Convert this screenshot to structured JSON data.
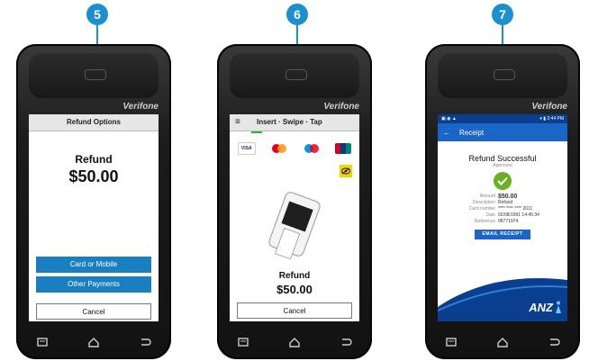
{
  "steps": [
    "5",
    "6",
    "7"
  ],
  "brand": "Verifone",
  "screen1": {
    "header": "Refund Options",
    "label": "Refund",
    "amount": "$50.00",
    "buttons": [
      "Card or Mobile",
      "Other Payments"
    ],
    "cancel": "Cancel"
  },
  "screen2": {
    "header": "Insert · Swipe · Tap",
    "cards": [
      "VISA",
      "mastercard",
      "maestro",
      "UnionPay"
    ],
    "label": "Refund",
    "amount": "$50.00",
    "cancel": "Cancel"
  },
  "screen3": {
    "time": "2:44 PM",
    "appbar_title": "Receipt",
    "result_title": "Refund Successful",
    "result_subtitle": "Approved",
    "details": [
      {
        "k": "Amount",
        "v": "$50.00"
      },
      {
        "k": "Description",
        "v": "Refund"
      },
      {
        "k": "Card number",
        "v": "**** **** **** 2011"
      },
      {
        "k": "Date",
        "v": "02/08/1991 14:45:34"
      },
      {
        "k": "Reference",
        "v": "08771974"
      }
    ],
    "email_button": "EMAIL RECEIPT",
    "logo": "ANZ"
  },
  "colors": {
    "accent": "#1b8fd0",
    "button_blue": "#1a7fc1",
    "anz_blue": "#0a3f8f",
    "success_green": "#6ab023"
  }
}
